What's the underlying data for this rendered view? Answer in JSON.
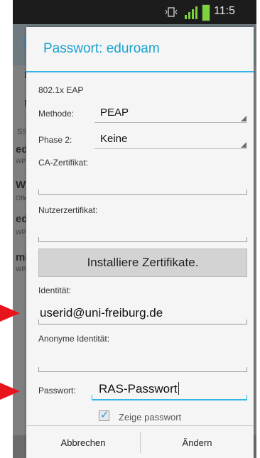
{
  "status_bar": {
    "time": "11:5"
  },
  "background": {
    "tabs": [
      "L",
      "N"
    ],
    "section": "SSI",
    "networks": [
      {
        "name": "edu",
        "sub": "WP"
      },
      {
        "name": "WL",
        "sub": "Offe"
      },
      {
        "name": "edu",
        "sub": "WP"
      },
      {
        "name": "mi",
        "sub": "WPA"
      }
    ]
  },
  "dialog": {
    "title": "Passwort: eduroam",
    "eap_label": "802.1x EAP",
    "method_label": "Methode:",
    "method_value": "PEAP",
    "phase2_label": "Phase 2:",
    "phase2_value": "Keine",
    "ca_cert_label": "CA-Zertifikat:",
    "user_cert_label": "Nutzerzertifikat:",
    "install_button": "Installiere Zertifikate.",
    "identity_label": "Identität:",
    "identity_value": "userid@uni-freiburg.de",
    "anon_identity_label": "Anonyme Identität:",
    "password_label": "Passwort:",
    "password_value": "RAS-Passwort",
    "show_password_label": "Zeige passwort",
    "show_password_checked": true,
    "cancel_button": "Abbrechen",
    "change_button": "Ändern"
  },
  "colors": {
    "accent": "#33b5e5",
    "title": "#1ba1cf",
    "pointer": "#e8141b"
  }
}
